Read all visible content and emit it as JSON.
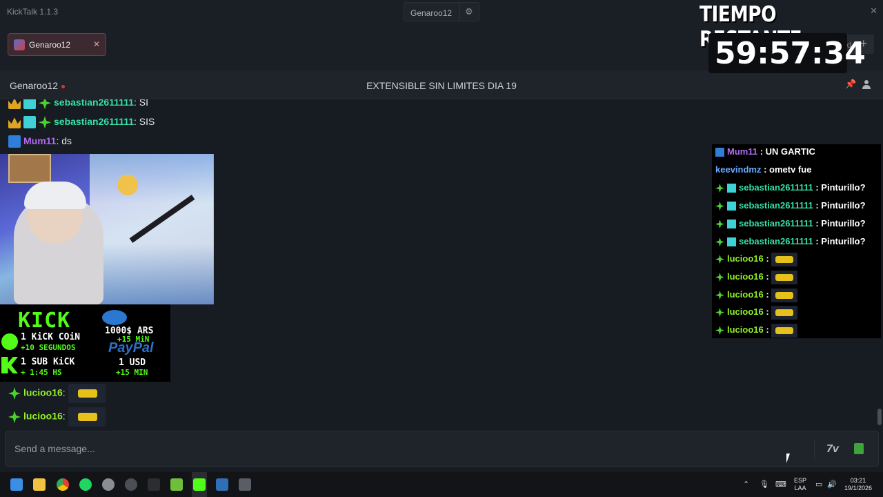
{
  "app": {
    "title": "KickTalk 1.1.3",
    "center_user": "Genaroo12"
  },
  "tabs": [
    {
      "label": "Genaroo12"
    }
  ],
  "add_tab": {
    "label": "Add",
    "plus": "+"
  },
  "channel": {
    "name": "Genaroo12",
    "stream_title": "EXTENSIBLE SIN LIMITES DIA 19"
  },
  "messages": [
    {
      "user": "sebastian2611111",
      "text": "SI",
      "color": "#36e0a6"
    },
    {
      "user": "sebastian2611111",
      "text": "SIS",
      "color": "#36e0a6"
    },
    {
      "user": "Mum11",
      "text": "ds",
      "color": "#b06cf0"
    },
    {
      "user": "lucioo16",
      "color": "#92f028"
    },
    {
      "user": "lucioo16",
      "color": "#92f028"
    }
  ],
  "donation_panel": {
    "brand": "KICK",
    "line1": "1 KiCK COiN",
    "line1_sub": "+10 SEGUNDOS",
    "line2": "1 SUB KiCK",
    "line2_sub": "+ 1:45 HS",
    "line3": "1000$ ARS",
    "line3_sub": "+15 MiN",
    "paypal": "PayPal",
    "line4": "1 USD",
    "line4_sub": "+15 MIN"
  },
  "overlay_chat": [
    {
      "user": "Mum11",
      "text": ": UN GARTIC",
      "color": "#b06cf0"
    },
    {
      "user": "keevindmz",
      "text": ": ometv fue",
      "color": "#6aa8ff"
    },
    {
      "user": "sebastian2611111",
      "text": ": Pinturillo?",
      "color": "#36e0a6"
    },
    {
      "user": "sebastian2611111",
      "text": ": Pinturillo?",
      "color": "#36e0a6"
    },
    {
      "user": "sebastian2611111",
      "text": ": Pinturillo?",
      "color": "#36e0a6"
    },
    {
      "user": "sebastian2611111",
      "text": ": Pinturillo?",
      "color": "#36e0a6"
    },
    {
      "user": "lucioo16",
      "text": ":",
      "color": "#92f028"
    },
    {
      "user": "lucioo16",
      "text": ":",
      "color": "#92f028"
    },
    {
      "user": "lucioo16",
      "text": ":",
      "color": "#92f028"
    },
    {
      "user": "lucioo16",
      "text": ":",
      "color": "#92f028"
    },
    {
      "user": "lucioo16",
      "text": ":",
      "color": "#92f028"
    }
  ],
  "timer": {
    "title": "TIEMPO RESTANTE:",
    "value": "59:57:34"
  },
  "input": {
    "placeholder": "Send a message..."
  },
  "taskbar": {
    "lang": "ESP",
    "layout": "LAA",
    "time": "03:21",
    "date": "19/1/2026"
  },
  "colors": {
    "accent": "#53fc18",
    "live": "#e0323a"
  }
}
